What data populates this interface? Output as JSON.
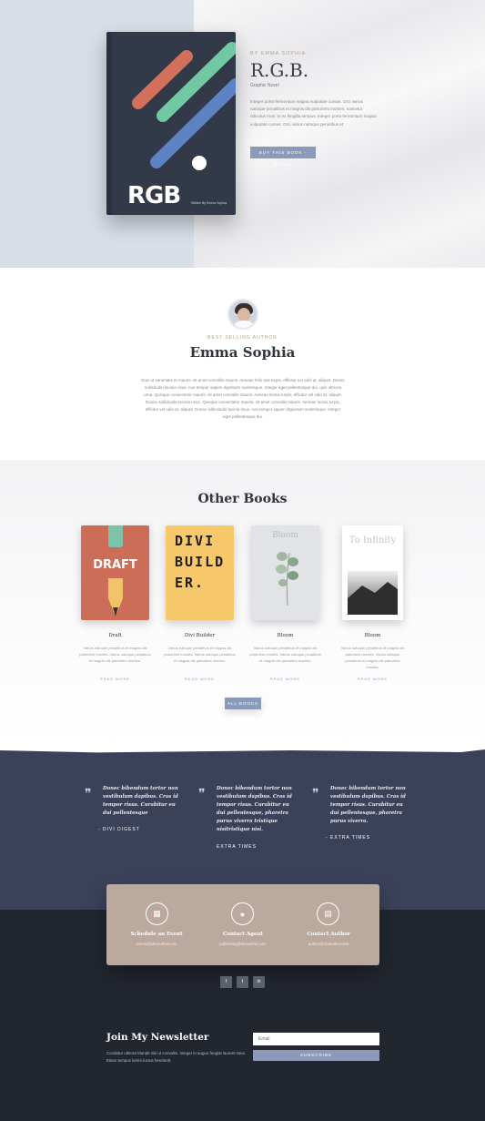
{
  "hero": {
    "author": "BY EMMA SOPHIA",
    "title": "R.G.B.",
    "tag": "Graphic Novel",
    "desc": "Integer porta fermentum magna vulputate cursus. Orci varius natoque penatibus et magnis dis parturient montes, nascetur ridiculus mus. In ex fringilla tempus. Integer porta fermentum magna vulputate cursus. Orci varius natoque penatibus et",
    "buy_label": "BUY THIS BOOK - $14.99",
    "book": {
      "title": "RGB",
      "sub": "Written By Emma Sophia"
    },
    "colors": {
      "stripe_red": "#d2705a",
      "stripe_green": "#72c8a3",
      "stripe_blue": "#5d83c4",
      "cover": "#323a4a"
    }
  },
  "author": {
    "label": "BEST SELLING AUTHOR",
    "name": "Emma Sophia",
    "bio": "Duis ut venenatis et mauris, sit amet convallis mauris. Aenean felis sed turpis, efficitur vel odio at, aliquet. Donec sollicitudin lacinia risus, non tempor sapien dignissim scelerisque. Integer eget pellentesque dui, quis ultrices urna. Quisque consectetur mauris, sit amet convallis mauris. Aenean lectus turpis, efficitur vel odio at, aliquet. Donec sollicitudin lacinia risus. Quisque consectetur mauris, sit amet convallis mauris. Aenean lectus turpis, efficitur vel odio at, aliquet. Donec sollicitudin lacinia risus, non tempor sapien dignissim scelerisque. Integer eget pellentesque dui."
  },
  "other_books": {
    "title": "Other Books",
    "books": [
      {
        "title": "Draft",
        "cover_text": "DRAFT",
        "desc": "Varius natoque penatibus et magnis dis parturient montes. Varius natoque penatibus et magnis dis parturient montes.",
        "link": "READ MORE"
      },
      {
        "title": "Divi Builder",
        "cover_text": "DIVI BUILDER.",
        "desc": "Varius natoque penatibus et magnis dis parturient montes. Varius natoque penatibus et magnis dis parturient montes.",
        "link": "READ MORE"
      },
      {
        "title": "Bloom",
        "cover_text": "Bloom",
        "desc": "Varius natoque penatibus et magnis dis parturient montes. Varius natoque penatibus et magnis dis parturient montes.",
        "link": "READ MORE"
      },
      {
        "title": "Bloom",
        "cover_text": "To Infinity",
        "desc": "Varius natoque penatibus et magnis dis parturient montes. Varius natoque penatibus et magnis dis parturient montes.",
        "link": "READ MORE"
      }
    ],
    "all_label": "ALL BOOKS"
  },
  "testimonials": [
    {
      "quote": "Donec bibendum tortor non vestibulum dapibus. Cras id tempor risus. Curabitur eu dui pellentesque",
      "source": "- DIVI DIGEST"
    },
    {
      "quote": "Donec bibendum tortor non vestibulum dapibus. Cras id tempor risus. Curabitur eu dui pellentesque, pharetra purus viverra tristique nisitristique nisi.",
      "source": "EXTRA TIMES"
    },
    {
      "quote": "Donec bibendum tortor non vestibulum dapibus. Cras id tempor risus. Curabitur eu dui pellentesque, pharetra purus viverra.",
      "source": "- EXTRA TIMES"
    }
  ],
  "contact": [
    {
      "icon": "calendar-icon",
      "title": "Schedule an Event",
      "sub": "events@diviauthor.com"
    },
    {
      "icon": "person-icon",
      "title": "Contact Agent",
      "sub": "publishing@diviauthor.com"
    },
    {
      "icon": "book-icon",
      "title": "Contact Author",
      "sub": "author@diviauthor.com"
    }
  ],
  "social": [
    "f",
    "t",
    "in"
  ],
  "newsletter": {
    "title": "Join My Newsletter",
    "desc": "Curabitur ultrices blandit nisi ut convallis. Integer in augue feugiat laoreet risus. Etiam tempus lorem luctus hendrerit.",
    "email_placeholder": "Email",
    "subscribe_label": "SUBSCRIBE"
  }
}
